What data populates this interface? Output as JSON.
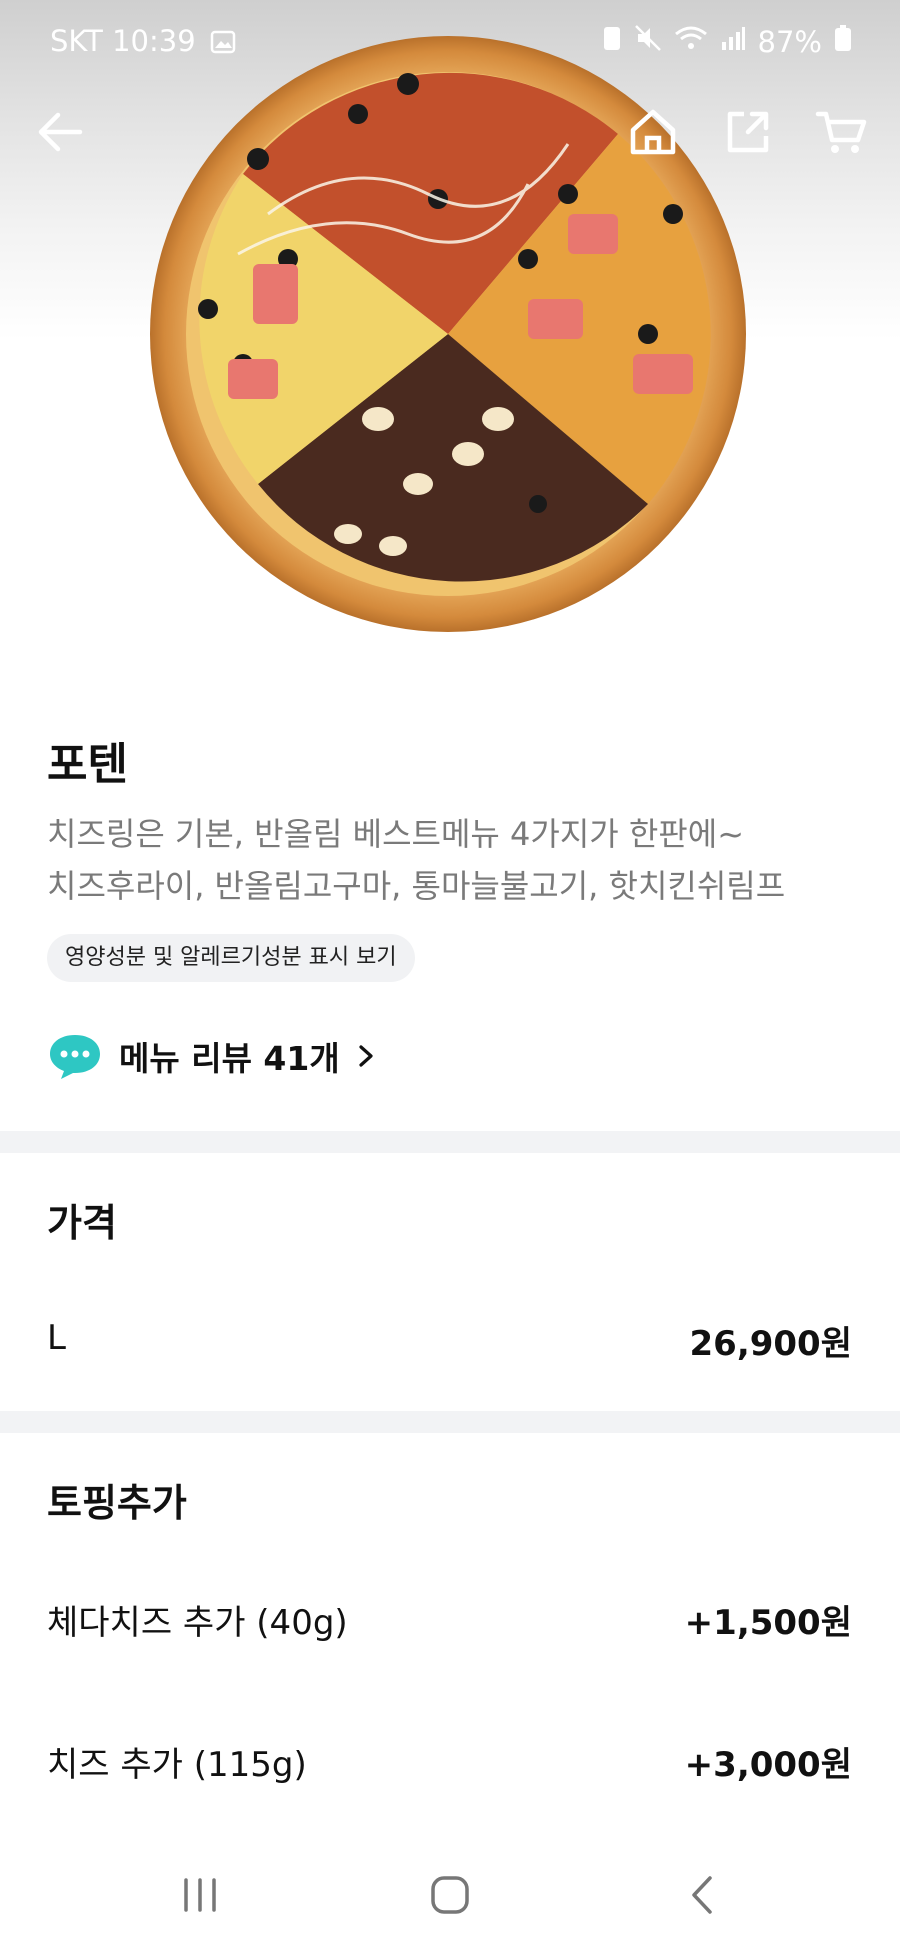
{
  "status_bar": {
    "carrier_time": "SKT 10:39",
    "battery": "87%"
  },
  "product": {
    "name": "포텐",
    "description_line1": "치즈링은 기본, 반올림 베스트메뉴 4가지가 한판에~",
    "description_line2": "치즈후라이, 반올림고구마, 통마늘불고기, 핫치킨쉬림프",
    "nutrition_button": "영양성분 및 알레르기성분 표시 보기",
    "review_link": "메뉴 리뷰 41개"
  },
  "price_section": {
    "title": "가격",
    "options": [
      {
        "size": "L",
        "price": "26,900원"
      }
    ]
  },
  "topping_section": {
    "title": "토핑추가",
    "items": [
      {
        "name": "체다치즈 추가 (40g)",
        "price": "+1,500원"
      },
      {
        "name": "치즈 추가 (115g)",
        "price": "+3,000원"
      }
    ]
  },
  "icons": {
    "back": "arrow-left-icon",
    "home": "home-icon",
    "share": "share-icon",
    "cart": "cart-icon",
    "review": "chat-bubble-icon",
    "nav_recent": "recent-apps-icon",
    "nav_home": "home-button-icon",
    "nav_back": "back-nav-icon"
  },
  "colors": {
    "accent_review": "#2ec7c3",
    "divider": "#f2f3f5",
    "description": "#7a7a7a"
  }
}
